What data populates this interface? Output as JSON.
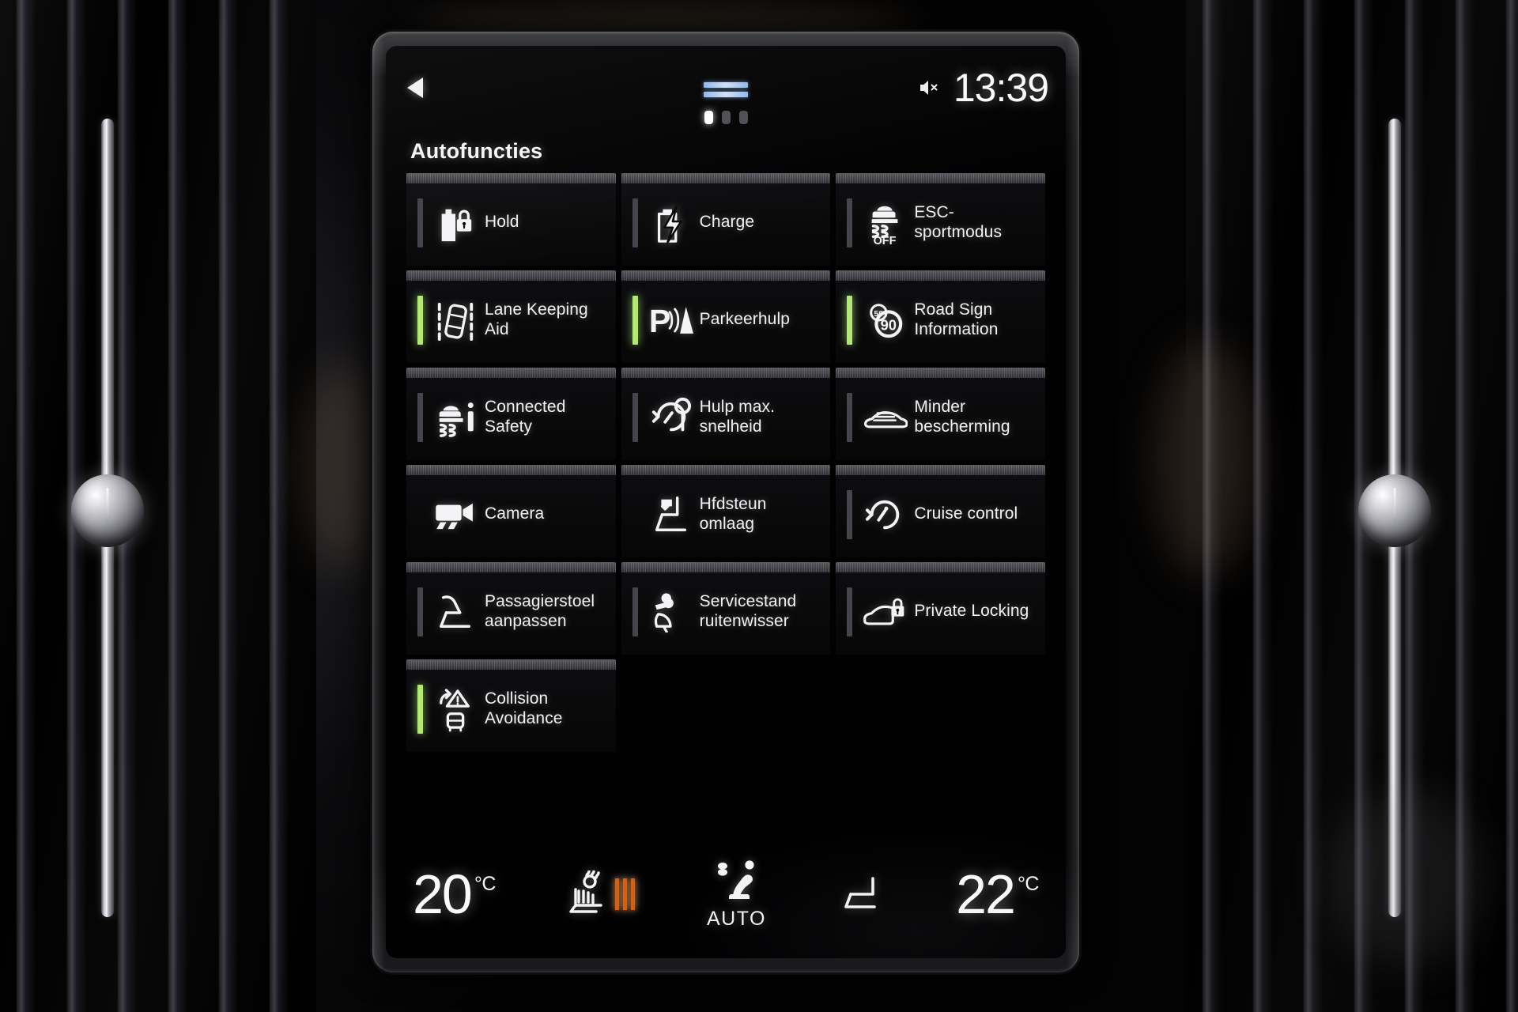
{
  "status_bar": {
    "back_icon": "back-arrow-icon",
    "drag_handle_icon": "drag-handle-icon",
    "mute_icon": "speaker-mute-icon",
    "clock": "13:39"
  },
  "page_indicator": {
    "total": 3,
    "active_index": 0
  },
  "header": {
    "title": "Autofuncties"
  },
  "colors": {
    "active_green": "#b2e878",
    "inactive_gray": "#45454b",
    "heat_orange": "#c8641e",
    "handle_blue": "#8fb6e8"
  },
  "tiles": [
    {
      "label": "Hold",
      "icon": "battery-lock-icon",
      "state": "off",
      "state_label": "inactive"
    },
    {
      "label": "Charge",
      "icon": "battery-charge-icon",
      "state": "off",
      "state_label": "inactive"
    },
    {
      "label": "ESC-sportmodus",
      "icon": "esc-off-icon",
      "state": "off",
      "state_label": "inactive"
    },
    {
      "label": "Lane Keeping\nAid",
      "icon": "lane-keeping-aid-icon",
      "state": "on",
      "state_label": "active"
    },
    {
      "label": "Parkeerhulp",
      "icon": "park-assist-icon",
      "state": "on",
      "state_label": "active"
    },
    {
      "label": "Road Sign\nInformation",
      "icon": "road-sign-90-icon",
      "state": "on",
      "state_label": "active"
    },
    {
      "label": "Connected\nSafety",
      "icon": "connected-safety-icon",
      "state": "off",
      "state_label": "inactive"
    },
    {
      "label": "Hulp max.\nsnelheid",
      "icon": "speed-limiter-icon",
      "state": "off",
      "state_label": "inactive"
    },
    {
      "label": "Minder\nbescherming",
      "icon": "reduced-guard-car-icon",
      "state": "off",
      "state_label": "inactive"
    },
    {
      "label": "Camera",
      "icon": "camera-icon",
      "state": "none",
      "state_label": "action"
    },
    {
      "label": "Hfdsteun\nomlaag",
      "icon": "headrest-down-icon",
      "state": "none",
      "state_label": "action"
    },
    {
      "label": "Cruise control",
      "icon": "cruise-control-icon",
      "state": "off",
      "state_label": "inactive"
    },
    {
      "label": "Passagierstoel\naanpassen",
      "icon": "passenger-seat-icon",
      "state": "off",
      "state_label": "inactive"
    },
    {
      "label": "Servicestand\nruitenwisser",
      "icon": "wiper-service-icon",
      "state": "off",
      "state_label": "inactive"
    },
    {
      "label": "Private Locking",
      "icon": "private-locking-icon",
      "state": "off",
      "state_label": "inactive"
    },
    {
      "label": "Collision\nAvoidance",
      "icon": "collision-avoidance-icon",
      "state": "on",
      "state_label": "active"
    }
  ],
  "climate": {
    "left_temp": {
      "value": "20",
      "unit": "°C"
    },
    "right_temp": {
      "value": "22",
      "unit": "°C"
    },
    "driver_seat_heat": {
      "icon": "heated-seat-icon",
      "level": 3
    },
    "auto_climate": {
      "icon": "fan-seat-airflow-icon",
      "label": "AUTO"
    },
    "passenger_seat": {
      "icon": "passenger-seat-heat-icon"
    }
  }
}
